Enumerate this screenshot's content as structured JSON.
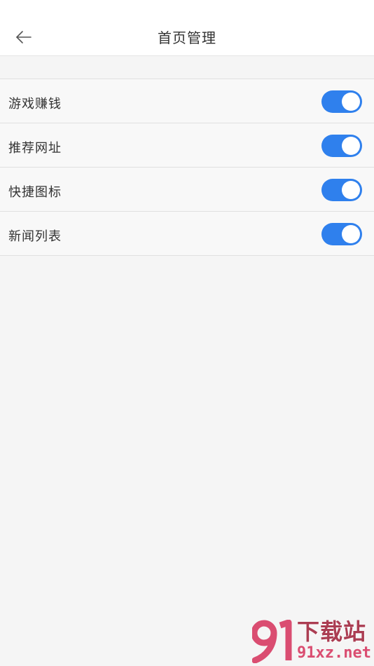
{
  "header": {
    "title": "首页管理",
    "back_icon": "arrow-left-icon"
  },
  "settings": [
    {
      "label": "游戏赚钱",
      "enabled": true
    },
    {
      "label": "推荐网址",
      "enabled": true
    },
    {
      "label": "快捷图标",
      "enabled": true
    },
    {
      "label": "新闻列表",
      "enabled": true
    }
  ],
  "colors": {
    "toggle_on": "#2f80ed",
    "background": "#f5f5f5",
    "watermark": "#a8344a"
  },
  "watermark": {
    "logo_text": "91",
    "site_name": "下载站",
    "domain": "91xz.net"
  }
}
